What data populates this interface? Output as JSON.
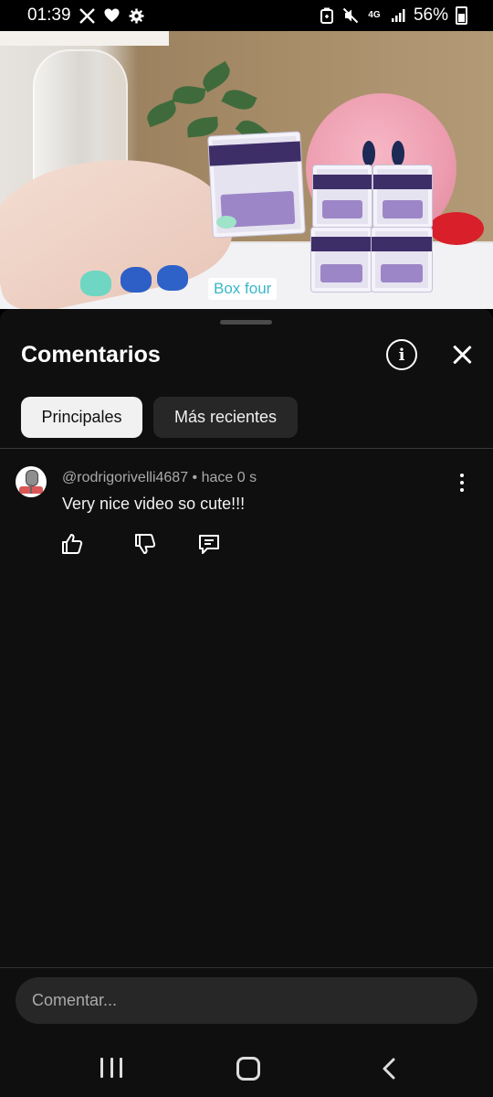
{
  "status_bar": {
    "time": "01:39",
    "left_icons": [
      "x-icon",
      "heart-icon",
      "gear-icon"
    ],
    "right_icons": [
      "battery-saver-icon",
      "mute-icon",
      "network-4g-icon",
      "signal-icon"
    ],
    "network": "4G",
    "battery_percent": "56%"
  },
  "video": {
    "caption": "Box four"
  },
  "comments_sheet": {
    "title": "Comentarios",
    "filters": [
      {
        "label": "Principales",
        "selected": true
      },
      {
        "label": "Más recientes",
        "selected": false
      }
    ],
    "comments": [
      {
        "author": "@rodrigorivelli4687",
        "time": "hace 0 s",
        "text": "Very nice video so cute!!!"
      }
    ],
    "input": {
      "placeholder": "Comentar..."
    }
  },
  "colors": {
    "sheet_background": "#0f0f0f",
    "chip_active": "#f1f1f1",
    "chip_inactive": "#272727",
    "caption_text": "#3bb6c9"
  }
}
